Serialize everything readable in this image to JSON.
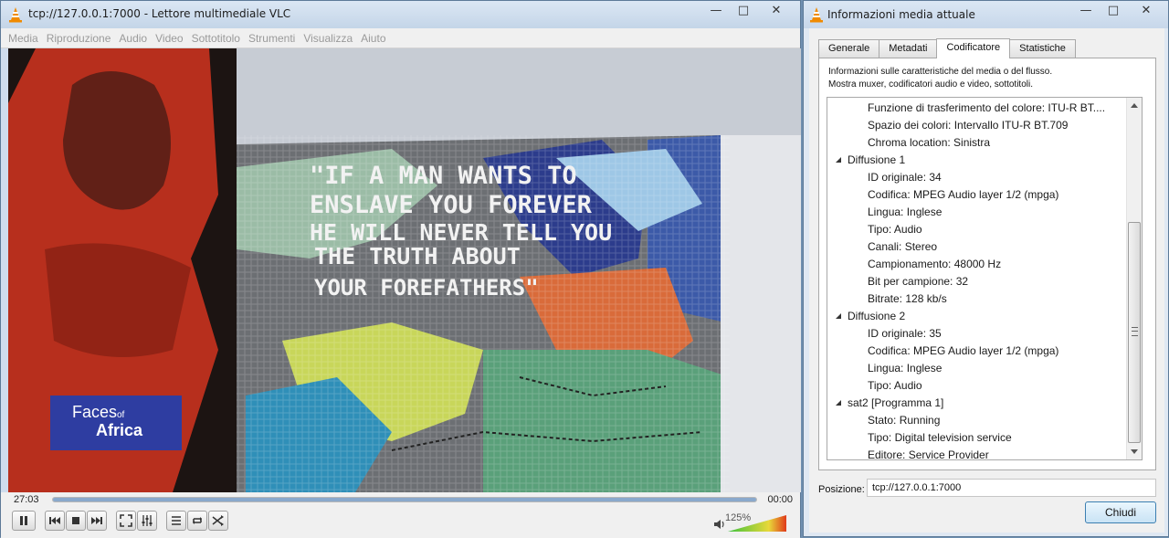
{
  "vlc": {
    "title": "tcp://127.0.0.1:7000 - Lettore multimediale VLC",
    "window_buttons": {
      "minimize": "—",
      "maximize": "□",
      "close": "✕"
    },
    "menu": [
      "Media",
      "Riproduzione",
      "Audio",
      "Video",
      "Sottotitolo",
      "Strumenti",
      "Visualizza",
      "Aiuto"
    ],
    "video": {
      "mural_lines": [
        "\"IF A MAN WANTS TO",
        "ENSLAVE YOU FOREVER",
        "HE WILL NEVER TELL YOU",
        "THE TRUTH ABOUT",
        "YOUR FOREFATHERS\""
      ],
      "logo_line1": "Faces",
      "logo_of": "of",
      "logo_line2": "Africa"
    },
    "controls": {
      "elapsed": "27:03",
      "remaining": "00:00",
      "progress": 1.0,
      "volume_label": "125%",
      "volume_level": 1.0
    }
  },
  "dialog": {
    "title": "Informazioni media attuale",
    "tabs": [
      "Generale",
      "Metadati",
      "Codificatore",
      "Statistiche"
    ],
    "active_tab": 2,
    "description_line1": "Informazioni sulle caratteristiche del media o del flusso.",
    "description_line2": "Mostra muxer, codificatori audio e video, sottotitoli.",
    "tree": [
      {
        "level": 2,
        "text": "Funzione di trasferimento del colore: ITU-R BT...."
      },
      {
        "level": 2,
        "text": "Spazio dei colori: Intervallo ITU-R BT.709"
      },
      {
        "level": 2,
        "text": "Chroma location: Sinistra"
      },
      {
        "level": 1,
        "text": "Diffusione 1",
        "expanded": true
      },
      {
        "level": 2,
        "text": "ID originale: 34"
      },
      {
        "level": 2,
        "text": "Codifica: MPEG Audio layer 1/2 (mpga)"
      },
      {
        "level": 2,
        "text": "Lingua: Inglese"
      },
      {
        "level": 2,
        "text": "Tipo: Audio"
      },
      {
        "level": 2,
        "text": "Canali: Stereo"
      },
      {
        "level": 2,
        "text": "Campionamento: 48000 Hz"
      },
      {
        "level": 2,
        "text": "Bit per campione: 32"
      },
      {
        "level": 2,
        "text": "Bitrate: 128 kb/s"
      },
      {
        "level": 1,
        "text": "Diffusione 2",
        "expanded": true
      },
      {
        "level": 2,
        "text": "ID originale: 35"
      },
      {
        "level": 2,
        "text": "Codifica: MPEG Audio layer 1/2 (mpga)"
      },
      {
        "level": 2,
        "text": "Lingua: Inglese"
      },
      {
        "level": 2,
        "text": "Tipo: Audio"
      },
      {
        "level": 1,
        "text": "sat2 [Programma 1]",
        "expanded": true
      },
      {
        "level": 2,
        "text": "Stato: Running"
      },
      {
        "level": 2,
        "text": "Tipo: Digital television service"
      },
      {
        "level": 2,
        "text": "Editore: Service Provider"
      }
    ],
    "position_label": "Posizione:",
    "position_value": "tcp://127.0.0.1:7000",
    "close_label": "Chiudi"
  },
  "colors": {
    "vlc_orange": "#f08a00",
    "logo_blue": "#1f3fb0",
    "mural_text": "#f2f2f2",
    "volume_green": "#3cc23c",
    "volume_red": "#e03a1a"
  }
}
